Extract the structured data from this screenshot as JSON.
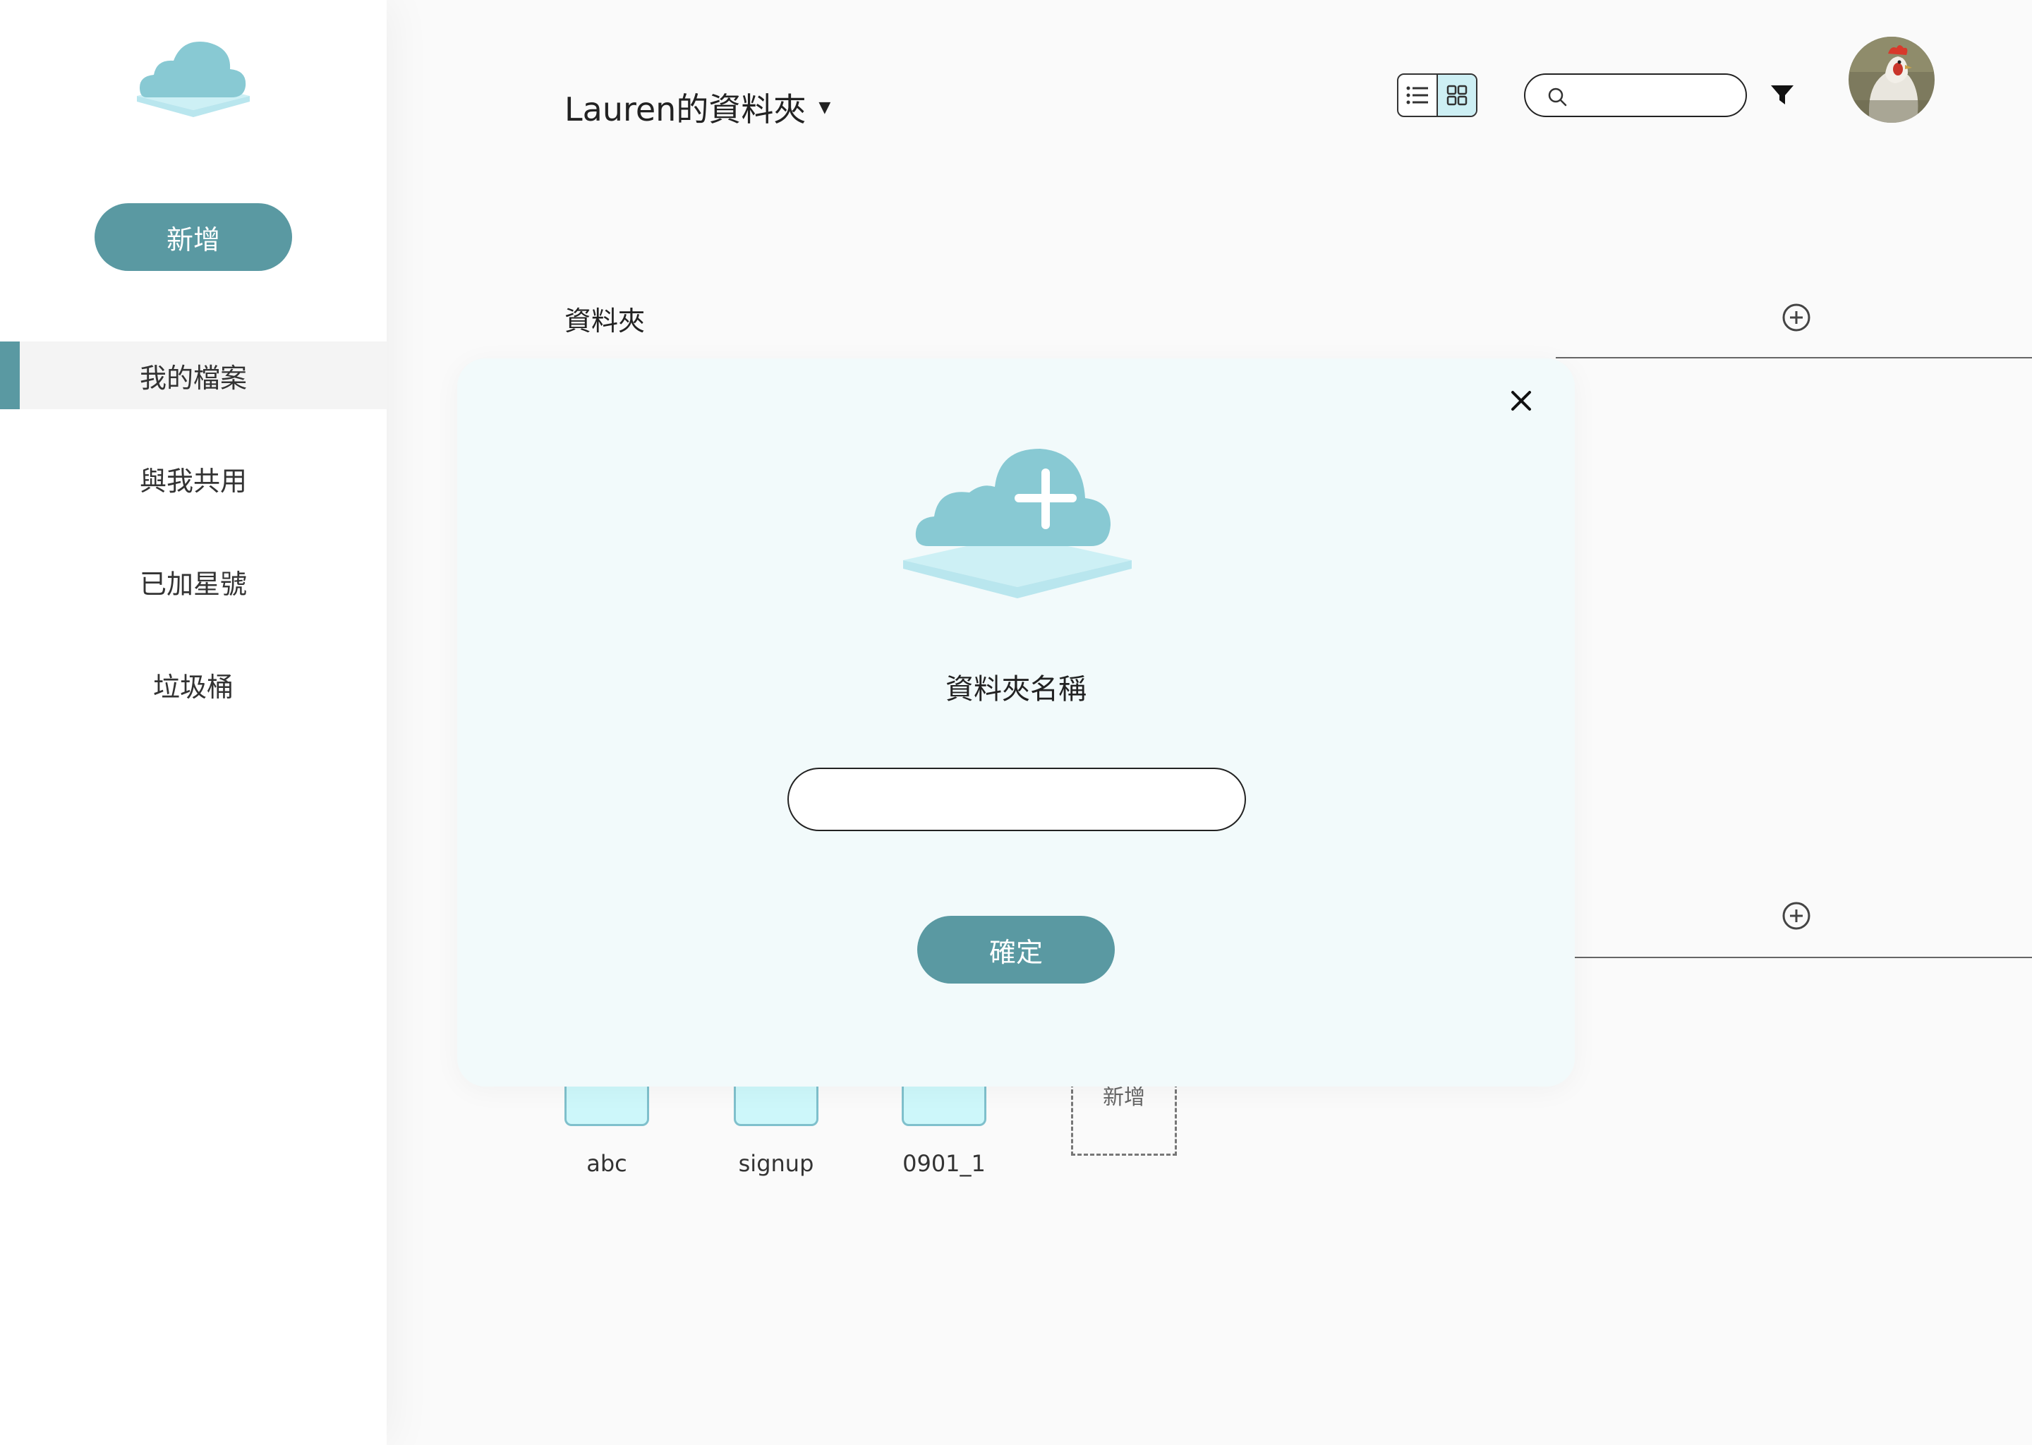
{
  "sidebar": {
    "new_button": "新增",
    "items": [
      {
        "label": "我的檔案",
        "active": true
      },
      {
        "label": "與我共用",
        "active": false
      },
      {
        "label": "已加星號",
        "active": false
      },
      {
        "label": "垃圾桶",
        "active": false
      }
    ]
  },
  "header": {
    "folder_title": "Lauren的資料夾",
    "caret_icon": "caret-down-icon",
    "view_modes": [
      "list",
      "grid"
    ],
    "active_view": "grid",
    "search": {
      "value": "",
      "placeholder": ""
    },
    "filter_icon": "filter-icon",
    "avatar": "user-avatar"
  },
  "sections": {
    "folders_title": "資料夾"
  },
  "files": [
    {
      "name": "abc"
    },
    {
      "name": "signup"
    },
    {
      "name": "0901_1"
    }
  ],
  "new_file_card": "新增",
  "modal": {
    "label": "資料夾名稱",
    "input_value": "",
    "confirm_label": "確定",
    "close_icon": "close-icon"
  },
  "colors": {
    "accent": "#5a99a2",
    "cloud": "#88c9d3",
    "cloud_light": "#cdf0f5",
    "file_fill": "#cdf7fa",
    "modal_bg": "#f2fafb"
  }
}
